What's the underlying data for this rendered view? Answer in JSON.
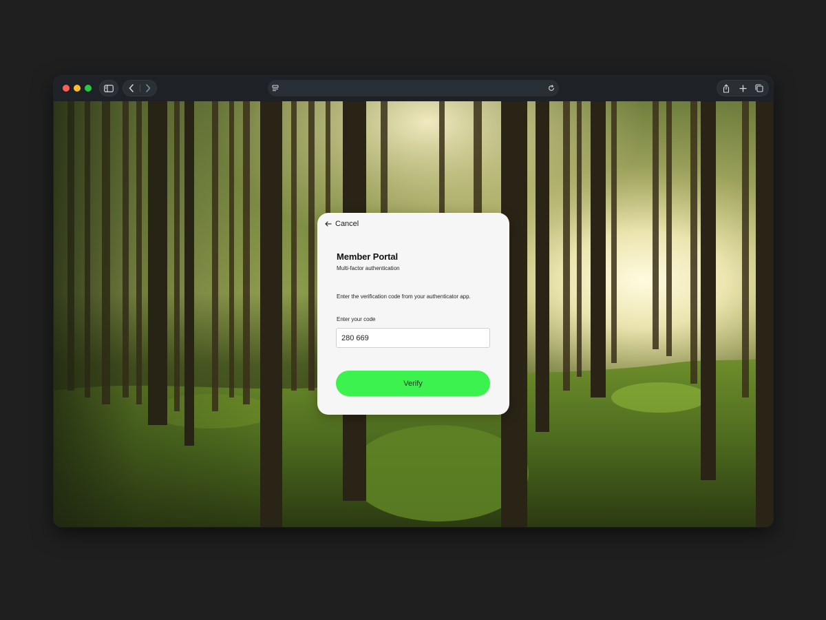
{
  "browser": {
    "url": "",
    "icons": {
      "sidebar": "sidebar-icon",
      "back": "chevron-left-icon",
      "forward": "chevron-right-icon",
      "page_settings": "page-settings-icon",
      "reload": "reload-icon",
      "share": "share-icon",
      "new_tab": "plus-icon",
      "tabs": "tabs-overview-icon"
    },
    "colors": {
      "close": "#ff5f57",
      "minimize": "#febc2e",
      "zoom": "#28c840"
    }
  },
  "background": {
    "image": "forest-photo"
  },
  "dialog": {
    "cancel_label": "Cancel",
    "title": "Member Portal",
    "subtitle": "Multi-factor authentication",
    "instruction": "Enter the verification code from your authenticator app.",
    "code_label": "Enter your code",
    "code_value": "280 669",
    "verify_label": "Verify",
    "colors": {
      "card": "#f6f6f6",
      "verify_button": "#3cf24f"
    }
  }
}
